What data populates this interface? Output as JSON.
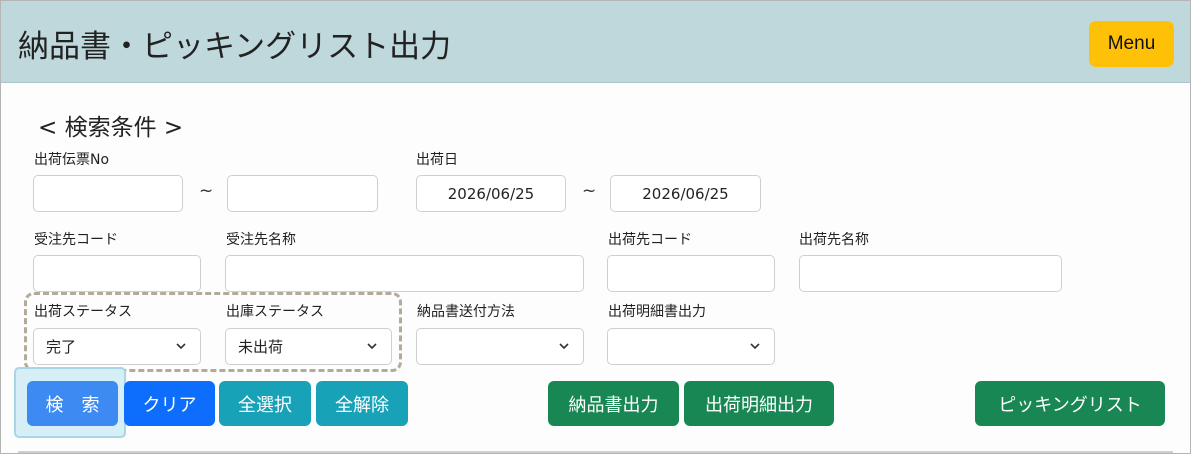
{
  "header": {
    "title": "納品書・ピッキングリスト出力",
    "menu_label": "Menu"
  },
  "search": {
    "section_title": "< 検索条件 >",
    "range_sep": "~",
    "slip_no": {
      "label": "出荷伝票No",
      "from": "",
      "to": ""
    },
    "ship_date": {
      "label": "出荷日",
      "from": "2026/06/25",
      "to": "2026/06/25"
    },
    "customer_code": {
      "label": "受注先コード",
      "value": ""
    },
    "customer_name": {
      "label": "受注先名称",
      "value": ""
    },
    "dest_code": {
      "label": "出荷先コード",
      "value": ""
    },
    "dest_name": {
      "label": "出荷先名称",
      "value": ""
    },
    "ship_status": {
      "label": "出荷ステータス",
      "value": "完了"
    },
    "warehouse_status": {
      "label": "出庫ステータス",
      "value": "未出荷"
    },
    "delivery_method": {
      "label": "納品書送付方法",
      "value": ""
    },
    "detail_output": {
      "label": "出荷明細書出力",
      "value": ""
    }
  },
  "buttons": {
    "search": "検　索",
    "clear": "クリア",
    "select_all": "全選択",
    "deselect_all": "全解除",
    "invoice_output": "納品書出力",
    "detail_output": "出荷明細出力",
    "picking_list": "ピッキングリスト"
  },
  "colors": {
    "header_bg": "#bfd8dc",
    "menu_btn": "#ffc107",
    "primary": "#0d6efd",
    "search_btn": "#3d8bf2",
    "info": "#17a2b8",
    "success": "#198754"
  }
}
